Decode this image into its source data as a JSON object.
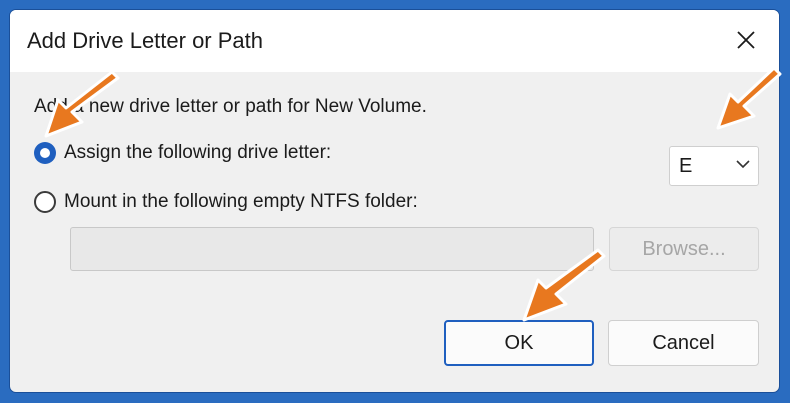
{
  "dialog": {
    "title": "Add Drive Letter or Path",
    "description": "Add a new drive letter or path for New Volume.",
    "options": [
      {
        "label": "Assign the following drive letter:",
        "selected": true
      },
      {
        "label": "Mount in the following empty NTFS folder:",
        "selected": false
      }
    ],
    "drive_letter": "E",
    "folder_path": "",
    "browse_label": "Browse...",
    "ok_label": "OK",
    "cancel_label": "Cancel"
  },
  "colors": {
    "accent": "#1f5fbf",
    "annotation_arrow": "#e8781f",
    "desktop_background": "#2a6cc0"
  },
  "icons": [
    "close-icon",
    "chevron-down-icon",
    "arrow-annotation"
  ]
}
